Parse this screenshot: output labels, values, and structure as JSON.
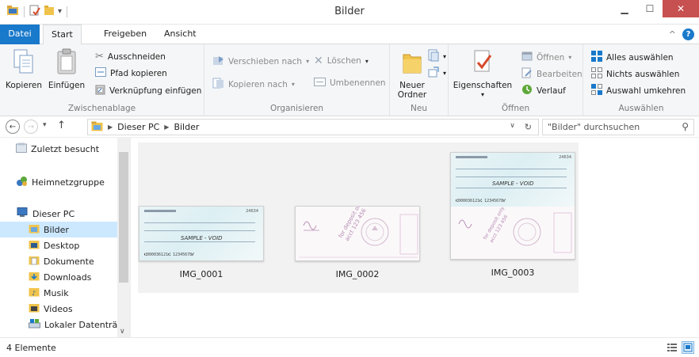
{
  "window": {
    "title": "Bilder",
    "minimize_icon": "minimize-icon",
    "maximize_icon": "maximize-icon",
    "close_icon": "close-icon"
  },
  "quick_access": [
    "folder-icon",
    "properties-icon",
    "new-folder-icon",
    "customize-dropdown-icon"
  ],
  "tabs": [
    {
      "label": "Datei",
      "active": false
    },
    {
      "label": "Start",
      "active": true
    },
    {
      "label": "Freigeben",
      "active": false
    },
    {
      "label": "Ansicht",
      "active": false
    }
  ],
  "ribbon": {
    "clipboard": {
      "label": "Zwischenablage",
      "copy": "Kopieren",
      "paste": "Einfügen",
      "cut": "Ausschneiden",
      "copy_path": "Pfad kopieren",
      "paste_shortcut": "Verknüpfung einfügen"
    },
    "organize": {
      "label": "Organisieren",
      "move_to": "Verschieben nach",
      "copy_to": "Kopieren nach",
      "delete": "Löschen",
      "rename": "Umbenennen"
    },
    "new": {
      "label": "Neu",
      "new_folder_line1": "Neuer",
      "new_folder_line2": "Ordner"
    },
    "open": {
      "label": "Öffnen",
      "properties": "Eigenschaften",
      "open": "Öffnen",
      "edit": "Bearbeiten",
      "history": "Verlauf"
    },
    "select": {
      "label": "Auswählen",
      "select_all": "Alles auswählen",
      "select_none": "Nichts auswählen",
      "invert": "Auswahl umkehren"
    }
  },
  "address": {
    "crumbs": [
      "Dieser PC",
      "Bilder"
    ],
    "search_placeholder": "\"Bilder\" durchsuchen"
  },
  "nav": [
    {
      "label": "Zuletzt besucht",
      "icon": "recent-icon",
      "selected": false
    },
    {
      "label": "Heimnetzgruppe",
      "icon": "homegroup-icon",
      "selected": false
    },
    {
      "label": "Dieser PC",
      "icon": "computer-icon",
      "selected": false
    },
    {
      "label": "Bilder",
      "icon": "pictures-folder-icon",
      "selected": true
    },
    {
      "label": "Desktop",
      "icon": "desktop-folder-icon",
      "selected": false
    },
    {
      "label": "Dokumente",
      "icon": "documents-folder-icon",
      "selected": false
    },
    {
      "label": "Downloads",
      "icon": "downloads-folder-icon",
      "selected": false
    },
    {
      "label": "Musik",
      "icon": "music-folder-icon",
      "selected": false
    },
    {
      "label": "Videos",
      "icon": "videos-folder-icon",
      "selected": false
    },
    {
      "label": "Lokaler Datenträg",
      "icon": "drive-icon",
      "selected": false
    }
  ],
  "files": [
    {
      "name": "IMG_0001",
      "check_no": "24634",
      "void_text": "SAMPLE - VOID",
      "micr": "⑆000036121⑆ 12345678⑈"
    },
    {
      "name": "IMG_0002"
    },
    {
      "name": "IMG_0003",
      "check_no": "24634",
      "void_text": "SAMPLE - VOID",
      "micr": "⑆000036121⑆ 12345678⑈"
    }
  ],
  "status": {
    "count": "4 Elemente"
  },
  "colors": {
    "accent": "#1979ca",
    "selected": "#cce8ff",
    "ribbon_bg": "#f5f6f7",
    "close_red": "#c75050"
  }
}
